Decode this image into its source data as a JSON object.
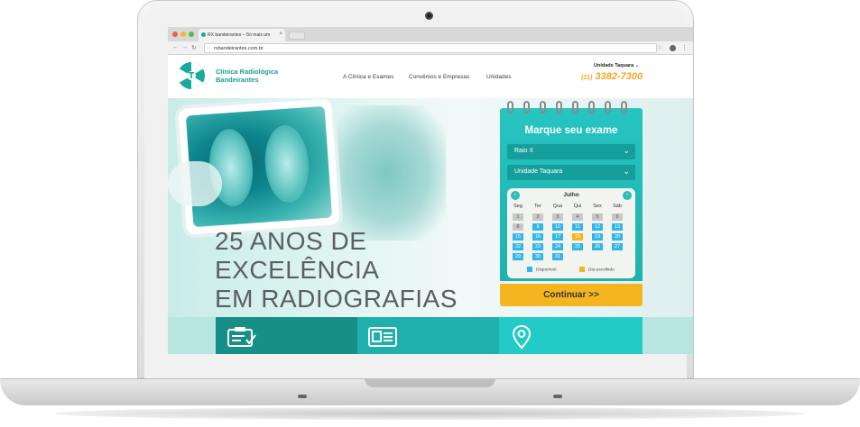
{
  "browser": {
    "tab_title": "RX bandeirantes – Só mais um",
    "url": "rxbandeirantes.com.br"
  },
  "site": {
    "brand_line1": "Clínica Radiológica",
    "brand_line2": "Bandeirantes",
    "nav": [
      "A Clínica e Exames",
      "Convênios e Empresas",
      "Unidades"
    ],
    "unit_selector": "Unidade Taquara",
    "phone_ddd": "(21)",
    "phone_number": "3382-7300"
  },
  "hero": {
    "line1": "25 ANOS DE",
    "line2": "EXCELÊNCIA",
    "line3": "EM RADIOGRAFIAS"
  },
  "booking": {
    "title": "Marque seu exame",
    "exam_select": "Raio X",
    "unit_select": "Unidade Taquara",
    "month": "Julho",
    "weekdays": [
      "Seg",
      "Ter",
      "Qua",
      "Qui",
      "Sex",
      "Sáb"
    ],
    "weeks": [
      [
        "1",
        "2",
        "3",
        "4",
        "5",
        "6"
      ],
      [
        "8",
        "9",
        "10",
        "11",
        "12",
        "13"
      ],
      [
        "15",
        "16",
        "17",
        "18",
        "19",
        "20"
      ],
      [
        "22",
        "23",
        "24",
        "25",
        "26",
        "27"
      ],
      [
        "29",
        "30",
        "31",
        "",
        "",
        ""
      ]
    ],
    "past_days": [
      "1",
      "2",
      "3",
      "4",
      "5",
      "6",
      "8"
    ],
    "chosen_day": "18",
    "legend_available": "Disponível",
    "legend_chosen": "Dia escolhido",
    "continue_label": "Continuar >>"
  },
  "colors": {
    "teal": "#1eb2b0",
    "orange": "#f5b51f",
    "available": "#32b6e8"
  }
}
